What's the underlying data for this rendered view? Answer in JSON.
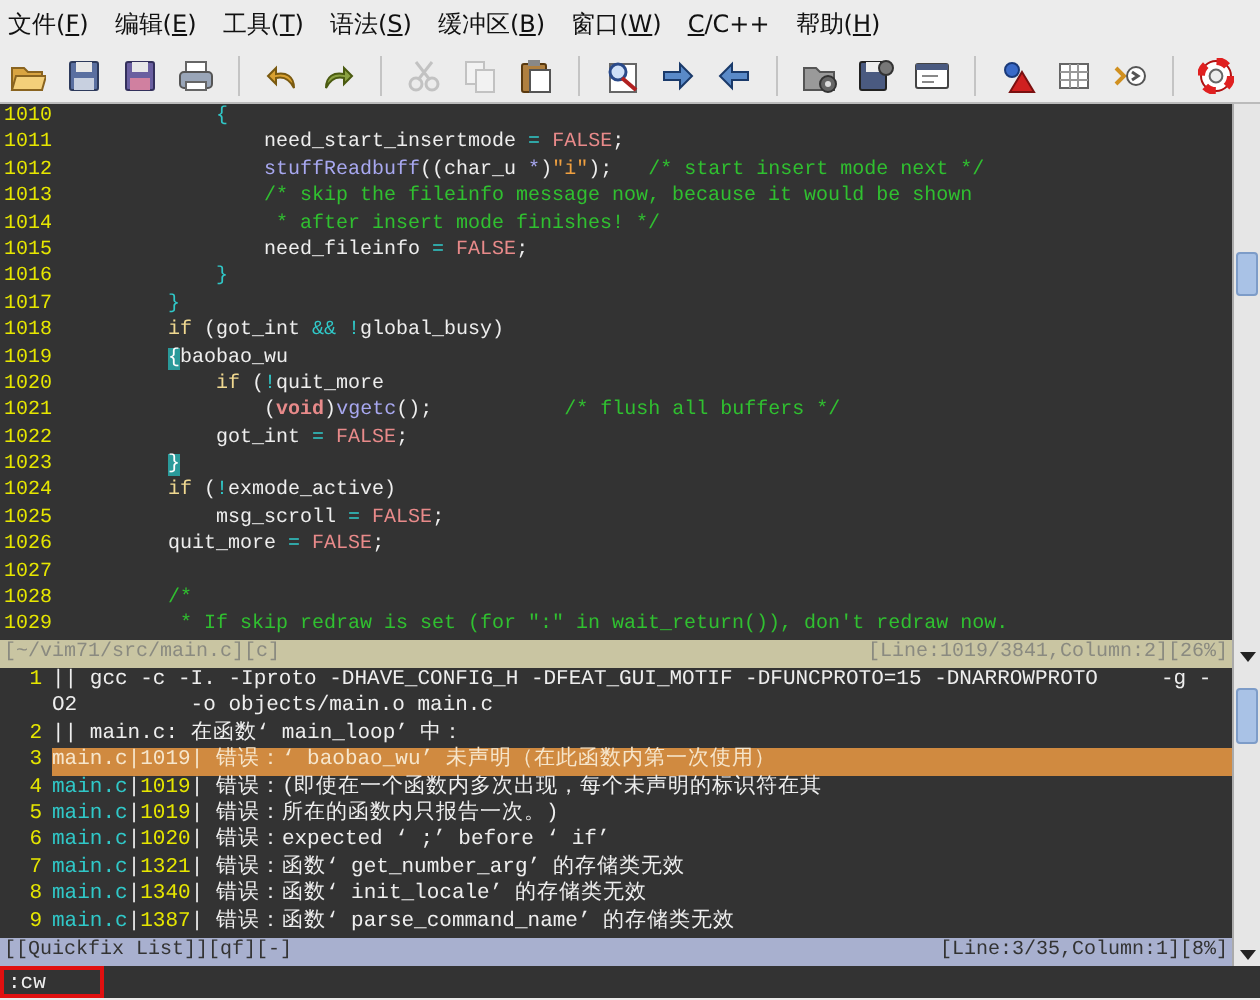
{
  "menu": [
    {
      "text": "文件(",
      "key": "F",
      "after": ")"
    },
    {
      "text": "编辑(",
      "key": "E",
      "after": ")"
    },
    {
      "text": "工具(",
      "key": "T",
      "after": ")"
    },
    {
      "text": "语法(",
      "key": "S",
      "after": ")"
    },
    {
      "text": "缓冲区(",
      "key": "B",
      "after": ")"
    },
    {
      "text": "窗口(",
      "key": "W",
      "after": ")"
    },
    {
      "key": "C",
      "after": "/C++"
    },
    {
      "text": "帮助(",
      "key": "H",
      "after": ")"
    }
  ],
  "toolbar": [
    {
      "kind": "open",
      "disabled": false
    },
    {
      "kind": "save",
      "disabled": false
    },
    {
      "kind": "saveall",
      "disabled": false
    },
    {
      "kind": "print",
      "disabled": false
    },
    {
      "kind": "separator"
    },
    {
      "kind": "undo",
      "disabled": false
    },
    {
      "kind": "redo",
      "disabled": false
    },
    {
      "kind": "separator"
    },
    {
      "kind": "cut",
      "disabled": true
    },
    {
      "kind": "copy",
      "disabled": true
    },
    {
      "kind": "paste",
      "disabled": false
    },
    {
      "kind": "separator"
    },
    {
      "kind": "find",
      "disabled": false
    },
    {
      "kind": "forward",
      "disabled": false
    },
    {
      "kind": "back",
      "disabled": false
    },
    {
      "kind": "separator"
    },
    {
      "kind": "loadsession",
      "disabled": false
    },
    {
      "kind": "savesession",
      "disabled": false
    },
    {
      "kind": "script",
      "disabled": false
    },
    {
      "kind": "separator"
    },
    {
      "kind": "make",
      "disabled": false
    },
    {
      "kind": "table",
      "disabled": false
    },
    {
      "kind": "tag",
      "disabled": false
    },
    {
      "kind": "separator"
    },
    {
      "kind": "help",
      "disabled": false
    }
  ],
  "editor": {
    "lines": [
      {
        "number": "1010",
        "segments": [
          {
            "kind": "brace",
            "text": "            {"
          }
        ]
      },
      {
        "number": "1011",
        "segments": [
          {
            "kind": "normal",
            "text": "                need_start_insertmode "
          },
          {
            "kind": "operator",
            "text": "= "
          },
          {
            "kind": "constant",
            "text": "FALSE"
          },
          {
            "kind": "normal",
            "text": ";"
          }
        ]
      },
      {
        "number": "1012",
        "segments": [
          {
            "kind": "function",
            "text": "                stuffReadbuff"
          },
          {
            "kind": "normal",
            "text": "((char_u "
          },
          {
            "kind": "function",
            "text": "*"
          },
          {
            "kind": "normal",
            "text": ")"
          },
          {
            "kind": "string",
            "text": "\"i\""
          },
          {
            "kind": "normal",
            "text": ");   "
          },
          {
            "kind": "comment",
            "text": "/* start insert mode next */"
          }
        ]
      },
      {
        "number": "1013",
        "segments": [
          {
            "kind": "comment",
            "text": "                /* skip the fileinfo message now, because it would be shown"
          }
        ]
      },
      {
        "number": "1014",
        "segments": [
          {
            "kind": "comment",
            "text": "                 * after insert mode finishes! */"
          }
        ]
      },
      {
        "number": "1015",
        "segments": [
          {
            "kind": "normal",
            "text": "                need_fileinfo "
          },
          {
            "kind": "operator",
            "text": "= "
          },
          {
            "kind": "constant",
            "text": "FALSE"
          },
          {
            "kind": "normal",
            "text": ";"
          }
        ]
      },
      {
        "number": "1016",
        "segments": [
          {
            "kind": "brace",
            "text": "            }"
          }
        ]
      },
      {
        "number": "1017",
        "segments": [
          {
            "kind": "brace",
            "text": "        }"
          }
        ]
      },
      {
        "number": "1018",
        "segments": [
          {
            "kind": "keyword",
            "text": "        if"
          },
          {
            "kind": "normal",
            "text": " (got_int "
          },
          {
            "kind": "operator",
            "text": "&& !"
          },
          {
            "kind": "normal",
            "text": "global_busy)"
          }
        ]
      },
      {
        "number": "1019",
        "segments": [
          {
            "kind": "cursor",
            "text": "        {"
          },
          {
            "kind": "normal",
            "text": "baobao_wu"
          }
        ]
      },
      {
        "number": "1020",
        "segments": [
          {
            "kind": "keyword",
            "text": "            if"
          },
          {
            "kind": "normal",
            "text": " ("
          },
          {
            "kind": "operator",
            "text": "!"
          },
          {
            "kind": "normal",
            "text": "quit_more"
          }
        ]
      },
      {
        "number": "1021",
        "segments": [
          {
            "kind": "normal",
            "text": "                ("
          },
          {
            "kind": "type",
            "text": "void"
          },
          {
            "kind": "normal",
            "text": ")"
          },
          {
            "kind": "function",
            "text": "vgetc"
          },
          {
            "kind": "normal",
            "text": "();           "
          },
          {
            "kind": "comment",
            "text": "/* flush all buffers */"
          }
        ]
      },
      {
        "number": "1022",
        "segments": [
          {
            "kind": "normal",
            "text": "            got_int "
          },
          {
            "kind": "operator",
            "text": "= "
          },
          {
            "kind": "constant",
            "text": "FALSE"
          },
          {
            "kind": "normal",
            "text": ";"
          }
        ]
      },
      {
        "number": "1023",
        "segments": [
          {
            "kind": "match",
            "text": "        }"
          }
        ]
      },
      {
        "number": "1024",
        "segments": [
          {
            "kind": "keyword",
            "text": "        if"
          },
          {
            "kind": "normal",
            "text": " ("
          },
          {
            "kind": "operator",
            "text": "!"
          },
          {
            "kind": "normal",
            "text": "exmode_active)"
          }
        ]
      },
      {
        "number": "1025",
        "segments": [
          {
            "kind": "normal",
            "text": "            msg_scroll "
          },
          {
            "kind": "operator",
            "text": "= "
          },
          {
            "kind": "constant",
            "text": "FALSE"
          },
          {
            "kind": "normal",
            "text": ";"
          }
        ]
      },
      {
        "number": "1026",
        "segments": [
          {
            "kind": "normal",
            "text": "        quit_more "
          },
          {
            "kind": "operator",
            "text": "= "
          },
          {
            "kind": "constant",
            "text": "FALSE"
          },
          {
            "kind": "normal",
            "text": ";"
          }
        ]
      },
      {
        "number": "1027"
      },
      {
        "number": "1028",
        "segments": [
          {
            "kind": "comment",
            "text": "        /*"
          }
        ]
      },
      {
        "number": "1029",
        "segments": [
          {
            "kind": "comment",
            "text": "         * If skip redraw is set (for \":\" in wait_return()), don't redraw now."
          }
        ]
      }
    ],
    "status": {
      "left": "[~/vim71/src/main.c][c]",
      "right": "[Line:1019/3841,Column:2][26%]"
    }
  },
  "quickfix": {
    "rows": [
      {
        "number": "1",
        "selected": false,
        "segments": [
          {
            "kind": "text",
            "text": "|| gcc -c -I. -Iproto -DHAVE_CONFIG_H -DFEAT_GUI_MOTIF -DFUNCPROTO=15 -DNARROWPROTO     -g -"
          }
        ],
        "continuation": "O2         -o objects/main.o main.c"
      },
      {
        "number": "2",
        "selected": false,
        "segments": [
          {
            "kind": "text",
            "text": "|| main.c: 在函数‘ main_loop’ 中："
          }
        ]
      },
      {
        "number": "3",
        "selected": true,
        "segments": [
          {
            "kind": "file",
            "text": "main.c"
          },
          {
            "kind": "text",
            "text": "|"
          },
          {
            "kind": "lnum",
            "text": "1019"
          },
          {
            "kind": "text",
            "text": "| 错误：‘ baobao_wu’ 未声明（在此函数内第一次使用）"
          }
        ]
      },
      {
        "number": "4",
        "selected": false,
        "segments": [
          {
            "kind": "file",
            "text": "main.c"
          },
          {
            "kind": "text",
            "text": "|"
          },
          {
            "kind": "lnum",
            "text": "1019"
          },
          {
            "kind": "text",
            "text": "| 错误：(即使在一个函数内多次出现，每个未声明的标识符在其"
          }
        ]
      },
      {
        "number": "5",
        "selected": false,
        "segments": [
          {
            "kind": "file",
            "text": "main.c"
          },
          {
            "kind": "text",
            "text": "|"
          },
          {
            "kind": "lnum",
            "text": "1019"
          },
          {
            "kind": "text",
            "text": "| 错误：所在的函数内只报告一次。)"
          }
        ]
      },
      {
        "number": "6",
        "selected": false,
        "segments": [
          {
            "kind": "file",
            "text": "main.c"
          },
          {
            "kind": "text",
            "text": "|"
          },
          {
            "kind": "lnum",
            "text": "1020"
          },
          {
            "kind": "text",
            "text": "| 错误：expected ‘ ;’ before ‘ if’"
          }
        ]
      },
      {
        "number": "7",
        "selected": false,
        "segments": [
          {
            "kind": "file",
            "text": "main.c"
          },
          {
            "kind": "text",
            "text": "|"
          },
          {
            "kind": "lnum",
            "text": "1321"
          },
          {
            "kind": "text",
            "text": "| 错误：函数‘ get_number_arg’ 的存储类无效"
          }
        ]
      },
      {
        "number": "8",
        "selected": false,
        "segments": [
          {
            "kind": "file",
            "text": "main.c"
          },
          {
            "kind": "text",
            "text": "|"
          },
          {
            "kind": "lnum",
            "text": "1340"
          },
          {
            "kind": "text",
            "text": "| 错误：函数‘ init_locale’ 的存储类无效"
          }
        ]
      },
      {
        "number": "9",
        "selected": false,
        "segments": [
          {
            "kind": "file",
            "text": "main.c"
          },
          {
            "kind": "text",
            "text": "|"
          },
          {
            "kind": "lnum",
            "text": "1387"
          },
          {
            "kind": "text",
            "text": "| 错误：函数‘ parse_command_name’ 的存储类无效"
          }
        ]
      }
    ],
    "status": {
      "left": "[[Quickfix List]][qf][-]",
      "right": "[Line:3/35,Column:1][8%]"
    }
  },
  "command_line": {
    "text": ":cw",
    "highlighted": true
  }
}
